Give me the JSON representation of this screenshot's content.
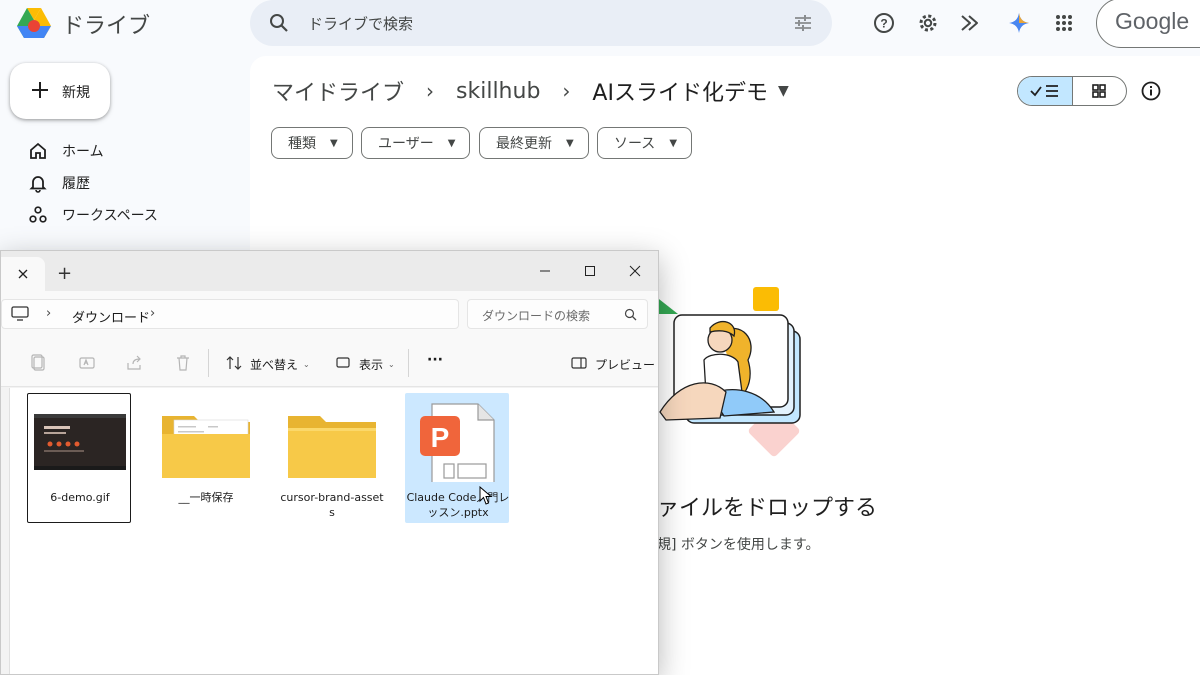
{
  "drive": {
    "app_name": "ドライブ",
    "search_placeholder": "ドライブで検索",
    "account_label": "Google",
    "new_button": "新規",
    "nav": [
      {
        "label": "ホーム",
        "icon": "home-icon"
      },
      {
        "label": "履歴",
        "icon": "bell-icon"
      },
      {
        "label": "ワークスペース",
        "icon": "workspaces-icon"
      }
    ],
    "breadcrumb": [
      "マイドライブ",
      "skillhub",
      "AIスライド化デモ"
    ],
    "filters": [
      "種類",
      "ユーザー",
      "最終更新",
      "ソース"
    ],
    "empty_state": {
      "title": "ァイルをドロップする",
      "subtitle": "規] ボタンを使用します。"
    },
    "colors": {
      "accent": "#c2e7ff",
      "background": "#f8fafd",
      "search": "#e9eef6"
    }
  },
  "explorer": {
    "address": {
      "folder": "ダウンロード"
    },
    "search_placeholder": "ダウンロードの検索",
    "toolbar": {
      "sort_label": "並べ替え",
      "view_label": "表示",
      "more_label": "···",
      "preview_label": "プレビュー"
    },
    "files": [
      {
        "name": "6-demo.gif",
        "type": "gif",
        "state": "focused"
      },
      {
        "name": "__一時保存",
        "type": "folder-with-content",
        "state": "normal"
      },
      {
        "name": "cursor-brand-assets",
        "type": "folder",
        "state": "normal"
      },
      {
        "name": "Claude Code入門レッスン.pptx",
        "type": "pptx",
        "state": "selected"
      }
    ]
  }
}
